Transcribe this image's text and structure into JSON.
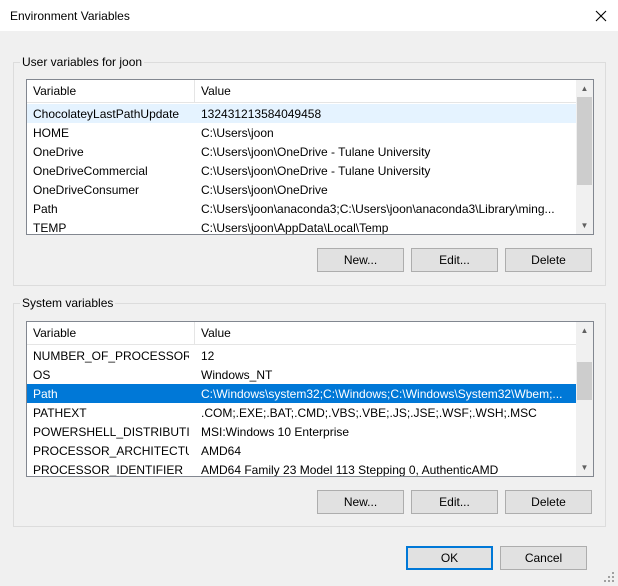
{
  "window": {
    "title": "Environment Variables"
  },
  "columns": {
    "variable": "Variable",
    "value": "Value"
  },
  "user": {
    "label": "User variables for joon",
    "rows": [
      {
        "name": "ChocolateyLastPathUpdate",
        "value": "132431213584049458"
      },
      {
        "name": "HOME",
        "value": "C:\\Users\\joon"
      },
      {
        "name": "OneDrive",
        "value": "C:\\Users\\joon\\OneDrive - Tulane University"
      },
      {
        "name": "OneDriveCommercial",
        "value": "C:\\Users\\joon\\OneDrive - Tulane University"
      },
      {
        "name": "OneDriveConsumer",
        "value": "C:\\Users\\joon\\OneDrive"
      },
      {
        "name": "Path",
        "value": "C:\\Users\\joon\\anaconda3;C:\\Users\\joon\\anaconda3\\Library\\ming..."
      },
      {
        "name": "TEMP",
        "value": "C:\\Users\\joon\\AppData\\Local\\Temp"
      }
    ],
    "buttons": {
      "new": "New...",
      "edit": "Edit...",
      "delete": "Delete"
    }
  },
  "system": {
    "label": "System variables",
    "rows": [
      {
        "name": "NUMBER_OF_PROCESSORS",
        "value": "12"
      },
      {
        "name": "OS",
        "value": "Windows_NT"
      },
      {
        "name": "Path",
        "value": "C:\\Windows\\system32;C:\\Windows;C:\\Windows\\System32\\Wbem;..."
      },
      {
        "name": "PATHEXT",
        "value": ".COM;.EXE;.BAT;.CMD;.VBS;.VBE;.JS;.JSE;.WSF;.WSH;.MSC"
      },
      {
        "name": "POWERSHELL_DISTRIBUTIO...",
        "value": "MSI:Windows 10 Enterprise"
      },
      {
        "name": "PROCESSOR_ARCHITECTURE",
        "value": "AMD64"
      },
      {
        "name": "PROCESSOR_IDENTIFIER",
        "value": "AMD64 Family 23 Model 113 Stepping 0, AuthenticAMD"
      }
    ],
    "buttons": {
      "new": "New...",
      "edit": "Edit...",
      "delete": "Delete"
    }
  },
  "footer": {
    "ok": "OK",
    "cancel": "Cancel"
  },
  "colors": {
    "selection": "#0078d7",
    "hover": "#e5f3ff",
    "border": "#828790"
  }
}
